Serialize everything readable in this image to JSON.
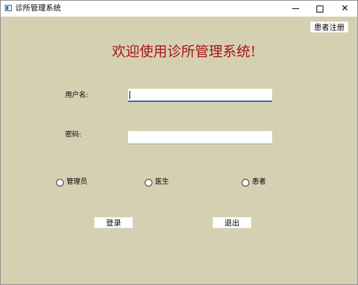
{
  "window": {
    "title": "诊所管理系统",
    "controls": {
      "minimize": "minimize-icon",
      "maximize": "maximize-icon",
      "close": "close-icon"
    }
  },
  "header": {
    "register_label": "患者注册",
    "welcome": "欢迎使用诊所管理系统!"
  },
  "form": {
    "username_label": "用户名:",
    "username_value": "",
    "password_label": "密码:",
    "password_value": ""
  },
  "roles": [
    {
      "label": "管理员",
      "selected": false
    },
    {
      "label": "医生",
      "selected": false
    },
    {
      "label": "患者",
      "selected": false
    }
  ],
  "actions": {
    "login_label": "登录",
    "exit_label": "退出"
  },
  "colors": {
    "background": "#d6d0b3",
    "welcome_text": "#a51414",
    "focus_underline": "#2b64a8"
  }
}
